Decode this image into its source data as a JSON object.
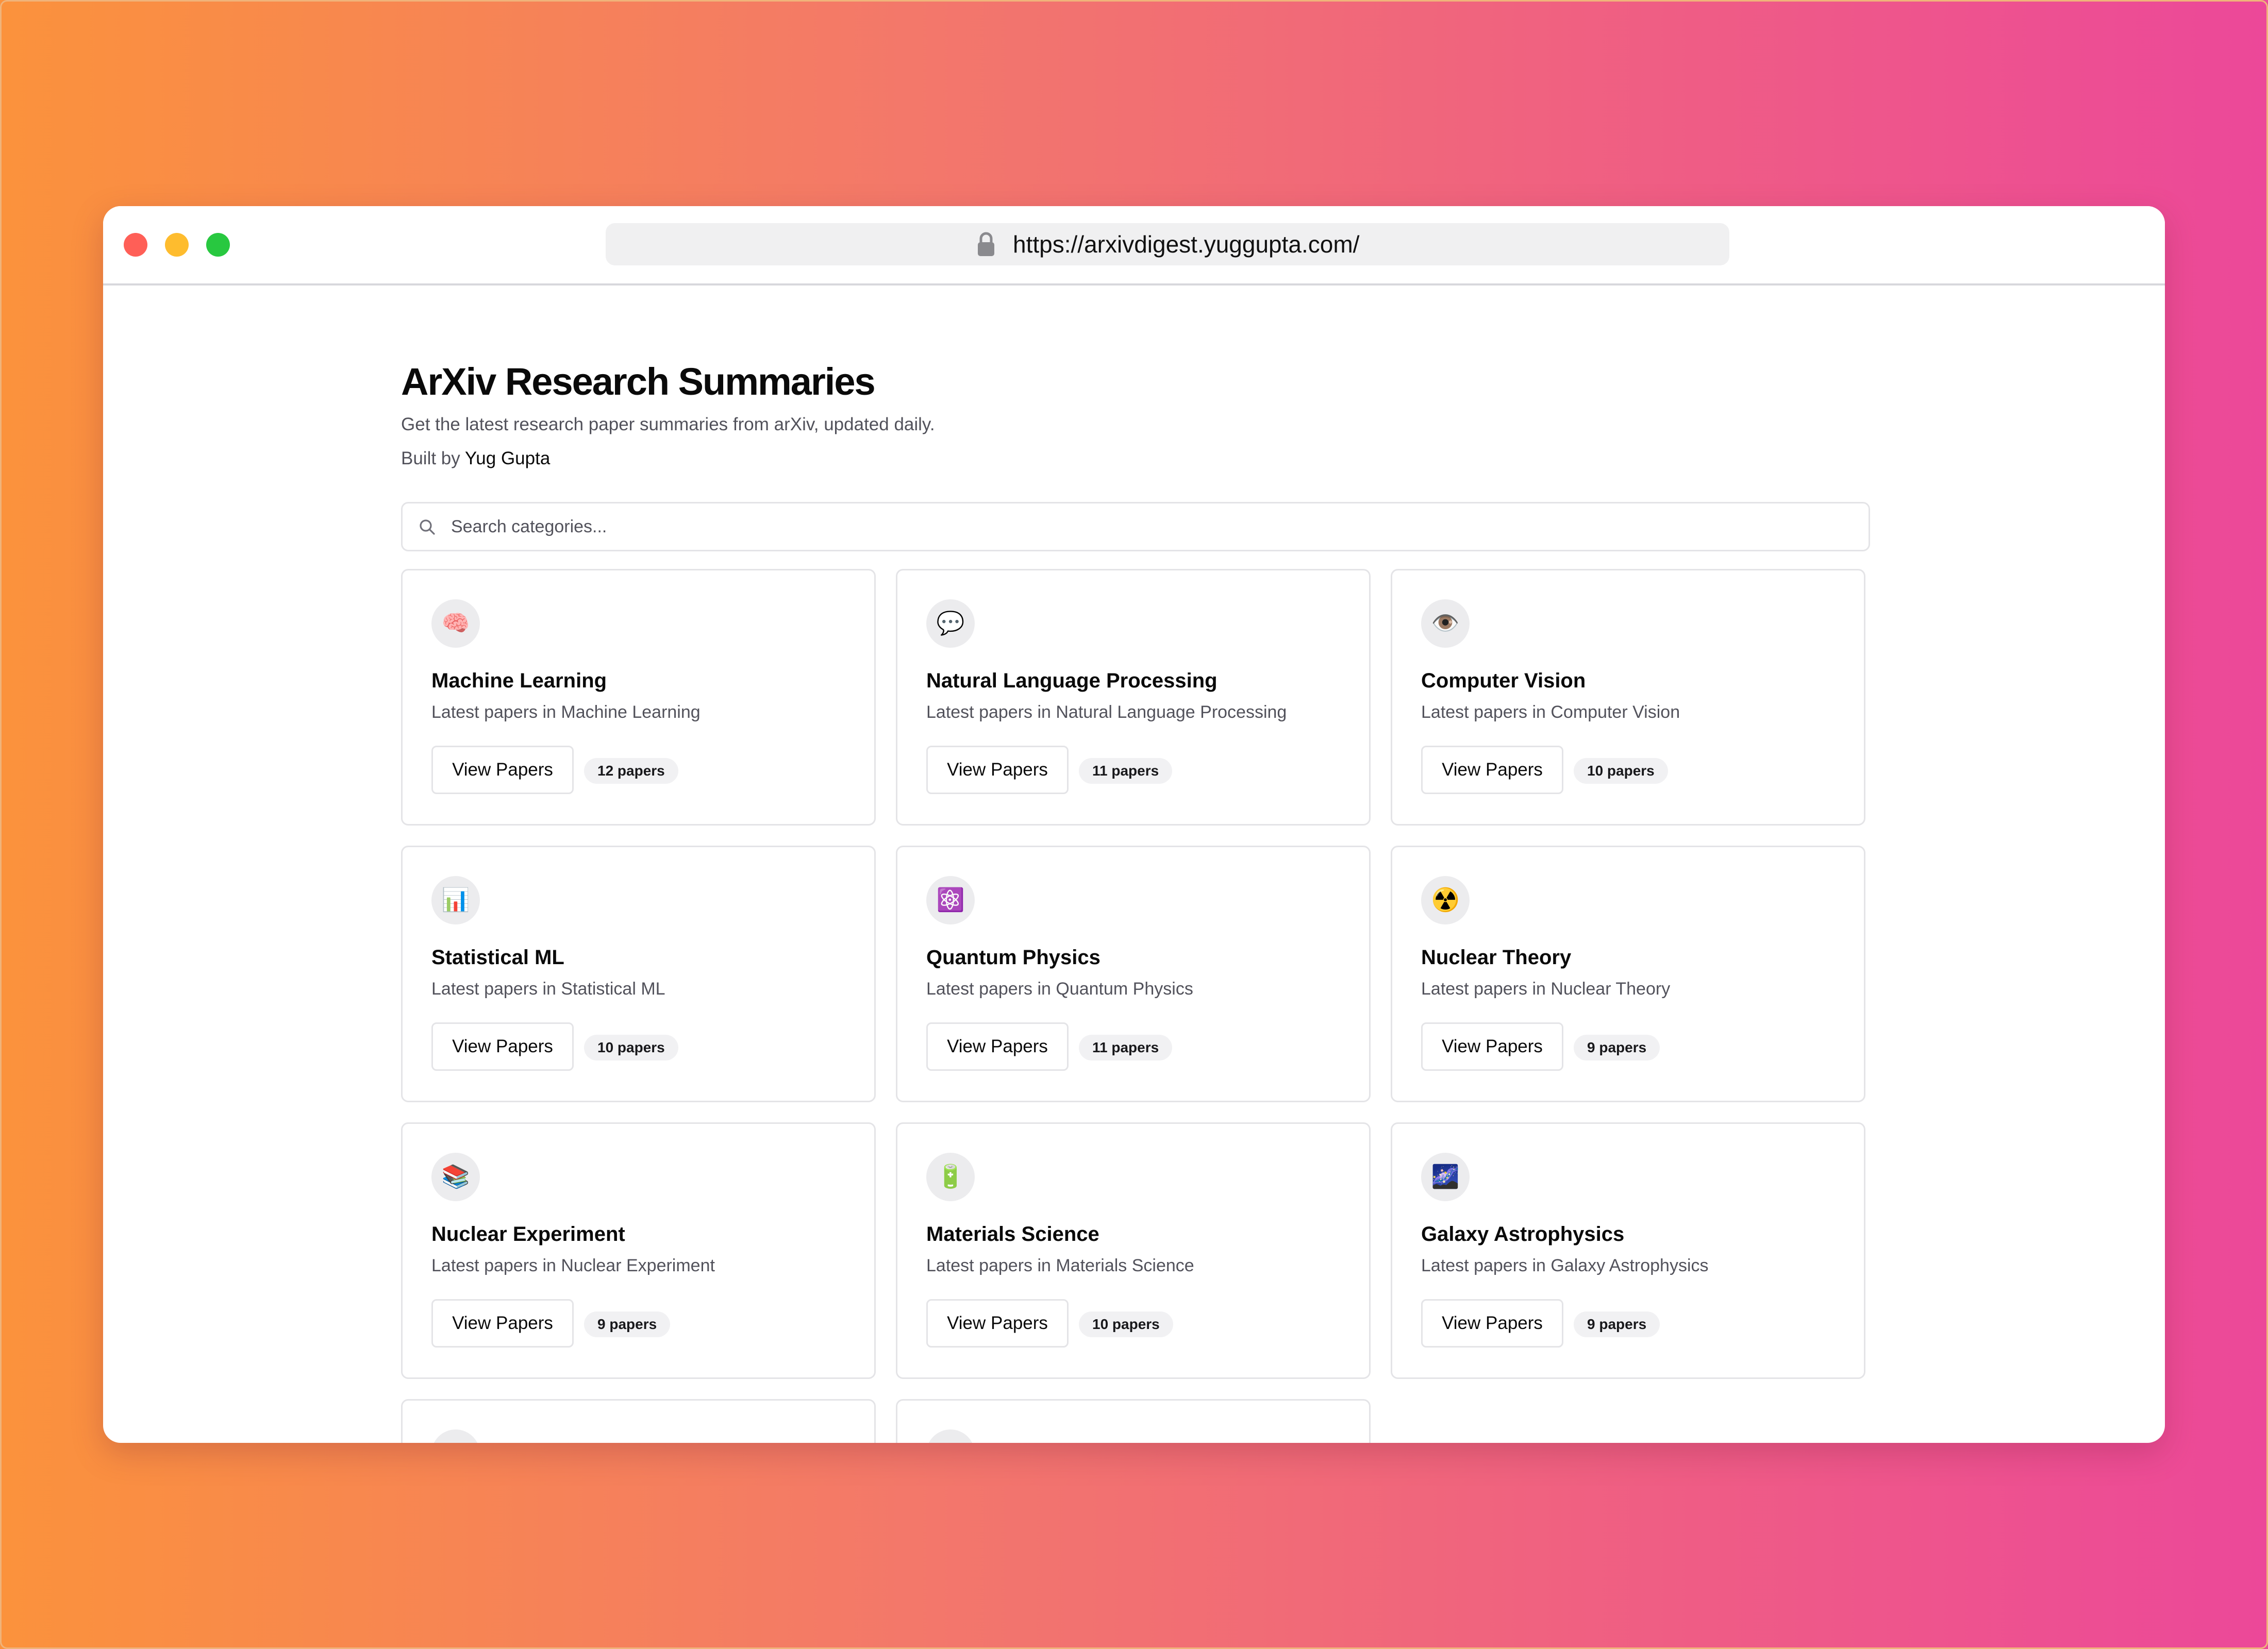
{
  "browser": {
    "url": "https://arxivdigest.yuggupta.com/"
  },
  "page": {
    "title": "ArXiv Research Summaries",
    "subtitle": "Get the latest research paper summaries from arXiv, updated daily.",
    "built_by_prefix": "Built by",
    "author": "Yug Gupta",
    "search_placeholder": "Search categories..."
  },
  "categories": [
    {
      "icon": "brain-icon",
      "emoji": "🧠",
      "name": "Machine Learning",
      "description": "Latest papers in Machine Learning",
      "button": "View Papers",
      "count": "12 papers"
    },
    {
      "icon": "speech-bubble-icon",
      "emoji": "💬",
      "name": "Natural Language Processing",
      "description": "Latest papers in Natural Language Processing",
      "button": "View Papers",
      "count": "11 papers"
    },
    {
      "icon": "eye-icon",
      "emoji": "👁️",
      "name": "Computer Vision",
      "description": "Latest papers in Computer Vision",
      "button": "View Papers",
      "count": "10 papers"
    },
    {
      "icon": "bar-chart-icon",
      "emoji": "📊",
      "name": "Statistical ML",
      "description": "Latest papers in Statistical ML",
      "button": "View Papers",
      "count": "10 papers"
    },
    {
      "icon": "atom-icon",
      "emoji": "⚛️",
      "name": "Quantum Physics",
      "description": "Latest papers in Quantum Physics",
      "button": "View Papers",
      "count": "11 papers"
    },
    {
      "icon": "radioactive-icon",
      "emoji": "☢️",
      "name": "Nuclear Theory",
      "description": "Latest papers in Nuclear Theory",
      "button": "View Papers",
      "count": "9 papers"
    },
    {
      "icon": "books-icon",
      "emoji": "📚",
      "name": "Nuclear Experiment",
      "description": "Latest papers in Nuclear Experiment",
      "button": "View Papers",
      "count": "9 papers"
    },
    {
      "icon": "battery-icon",
      "emoji": "🔋",
      "name": "Materials Science",
      "description": "Latest papers in Materials Science",
      "button": "View Papers",
      "count": "10 papers"
    },
    {
      "icon": "galaxy-icon",
      "emoji": "🌌",
      "name": "Galaxy Astrophysics",
      "description": "Latest papers in Galaxy Astrophysics",
      "button": "View Papers",
      "count": "9 papers"
    }
  ]
}
